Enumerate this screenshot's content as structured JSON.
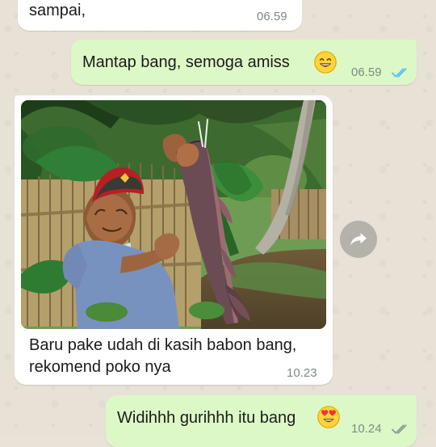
{
  "chat": {
    "messages": [
      {
        "direction": "incoming",
        "text": "sampai,",
        "time": "06.59"
      },
      {
        "direction": "outgoing",
        "text": "Mantap bang, semoga amiss",
        "emoji": "grinning-face-emoji",
        "time": "06.59",
        "status": "read"
      },
      {
        "direction": "incoming",
        "type": "image",
        "caption_lines": [
          "Baru pake udah di kasih babon bang,",
          "rekomend poko nya"
        ],
        "time": "10.23",
        "image_subject": "man-holding-catfish"
      },
      {
        "direction": "outgoing",
        "text": "Widihhh gurihhh itu bang",
        "emoji": "heart-eyes-emoji",
        "time": "10.24",
        "status": "delivered"
      }
    ],
    "forward_icon": "forward-arrow-icon"
  },
  "colors": {
    "wallpaper": "#e8e1d6",
    "incoming_bubble": "#ffffff",
    "outgoing_bubble": "#dcf8c6",
    "timestamp": "#7c8b86",
    "read_tick": "#4fc3f7",
    "delivered_tick": "#8a9a94"
  }
}
